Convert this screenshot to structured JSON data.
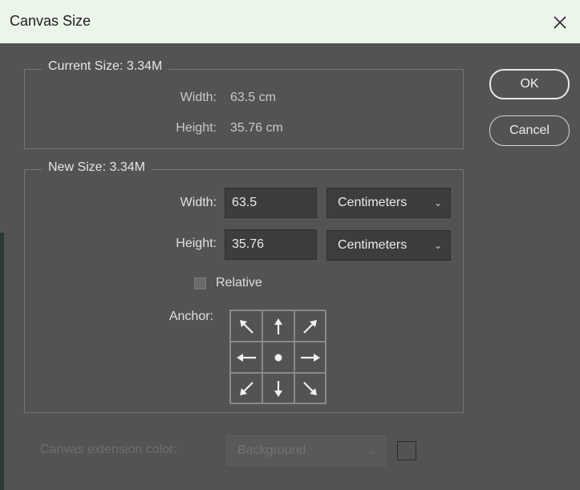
{
  "window": {
    "title": "Canvas Size",
    "close_icon": "close-icon"
  },
  "current_size": {
    "legend": "Current Size: 3.34M",
    "width_label": "Width:",
    "width_value": "63.5 cm",
    "height_label": "Height:",
    "height_value": "35.76 cm"
  },
  "new_size": {
    "legend": "New Size: 3.34M",
    "width_label": "Width:",
    "width_value": "63.5",
    "width_unit": "Centimeters",
    "height_label": "Height:",
    "height_value": "35.76",
    "height_unit": "Centimeters",
    "relative_label": "Relative",
    "relative_checked": false,
    "anchor_label": "Anchor:",
    "anchor_icons": [
      "arrow-up-left-icon",
      "arrow-up-icon",
      "arrow-up-right-icon",
      "arrow-left-icon",
      "anchor-center-dot-icon",
      "arrow-right-icon",
      "arrow-down-left-icon",
      "arrow-down-icon",
      "arrow-down-right-icon"
    ]
  },
  "extension": {
    "label": "Canvas extension color:",
    "value": "Background"
  },
  "buttons": {
    "ok": "OK",
    "cancel": "Cancel"
  },
  "colors": {
    "dialog_bg": "#535353",
    "titlebar_bg": "#ecf5ea",
    "field_bg": "#3d3d3d"
  }
}
